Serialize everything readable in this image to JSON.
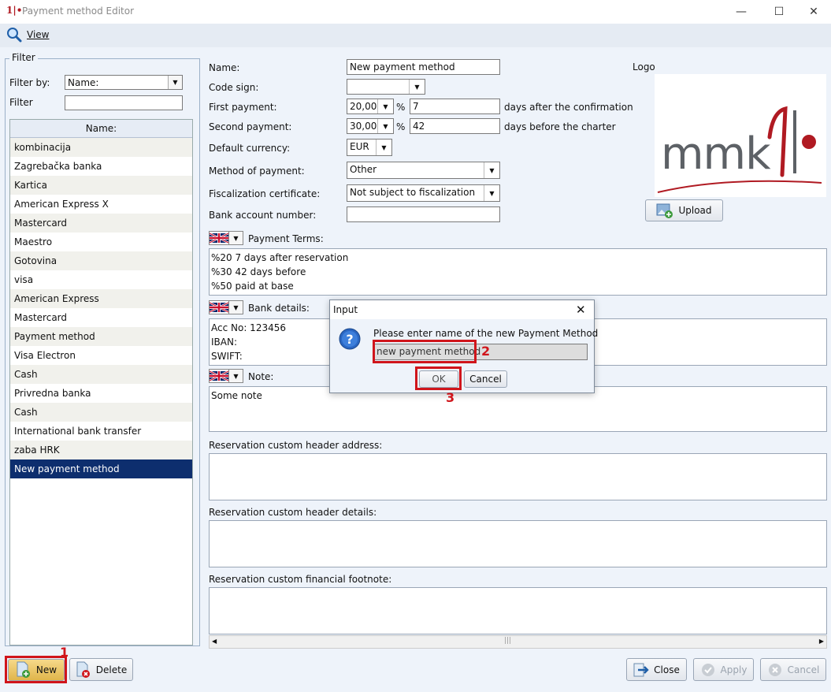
{
  "window": {
    "title": "Payment method Editor",
    "minimize_glyph": "—",
    "maximize_glyph": "☐",
    "close_glyph": "✕"
  },
  "menu": {
    "view": "View"
  },
  "filter": {
    "legend": "Filter",
    "filter_by_label": "Filter by:",
    "filter_by_value": "Name:",
    "filter_label": "Filter",
    "filter_value": ""
  },
  "list": {
    "header": "Name:",
    "items": [
      "kombinacija",
      "Zagrebačka banka",
      "Kartica",
      "American Express X",
      "Mastercard",
      "Maestro",
      "Gotovina",
      "visa",
      "American Express",
      "Mastercard",
      "Payment method",
      "Visa Electron",
      "Cash",
      "Privredna banka",
      "Cash",
      "International bank transfer",
      "zaba HRK",
      "New payment method"
    ],
    "selected_index": 17
  },
  "form": {
    "name_label": "Name:",
    "name_value": "New payment method",
    "code_sign_label": "Code sign:",
    "code_sign_value": "",
    "first_payment_label": "First payment:",
    "first_payment_percent": "20,00",
    "first_payment_days": "7",
    "first_payment_suffix": "days after the confirmation",
    "second_payment_label": "Second payment:",
    "second_payment_percent": "30,00",
    "second_payment_days": "42",
    "second_payment_suffix": "days before the charter",
    "percent_sign": "%",
    "currency_label": "Default currency:",
    "currency_value": "EUR",
    "method_label": "Method of payment:",
    "method_value": "Other",
    "fiscal_label": "Fiscalization certificate:",
    "fiscal_value": "Not subject to fiscalization",
    "bank_account_label": "Bank account number:",
    "bank_account_value": "",
    "logo_label": "Logo",
    "logo_text": "mmk",
    "upload_label": "Upload",
    "payment_terms_label": "Payment Terms:",
    "payment_terms": [
      "%20 7 days after reservation",
      "%30 42 days before",
      "%50 paid at base"
    ],
    "bank_details_label": "Bank details:",
    "bank_details": [
      "Acc No: 123456",
      "IBAN:",
      "SWIFT:"
    ],
    "note_label": "Note:",
    "note": [
      "Some note"
    ],
    "header_address_label": "Reservation custom header address:",
    "header_details_label": "Reservation custom header details:",
    "footnote_label": "Reservation custom financial footnote:"
  },
  "dialog": {
    "title": "Input",
    "message": "Please enter name of the new Payment Method",
    "input_value": "new payment method",
    "ok": "OK",
    "cancel": "Cancel",
    "close_glyph": "✕"
  },
  "buttons": {
    "new": "New",
    "delete": "Delete",
    "close": "Close",
    "apply": "Apply",
    "cancel": "Cancel"
  },
  "annotations": {
    "step1": "1",
    "step2": "2",
    "step3": "3"
  },
  "colors": {
    "selection": "#0d2e6e",
    "annotation": "#d0151b",
    "brand_red": "#b01a22",
    "brand_gray": "#5d6166"
  }
}
